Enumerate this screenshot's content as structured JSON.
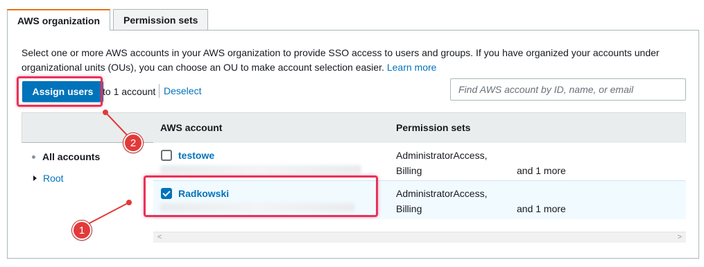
{
  "tabs": [
    {
      "label": "AWS organization",
      "active": true
    },
    {
      "label": "Permission sets",
      "active": false
    }
  ],
  "description": {
    "text": "Select one or more AWS accounts in your AWS organization to provide SSO access to users and groups. If you have organized your accounts under organizational units (OUs), you can choose an OU to make account selection easier. ",
    "learn_more": "Learn more"
  },
  "toolbar": {
    "assign_label": "Assign users",
    "assign_suffix": "to 1 account",
    "deselect_label": "Deselect",
    "search_placeholder": "Find AWS account by ID, name, or email"
  },
  "tree": {
    "all_accounts": "All accounts",
    "root": "Root"
  },
  "table": {
    "headers": [
      "AWS account",
      "Permission sets"
    ],
    "rows": [
      {
        "name": "testowe",
        "checked": false,
        "perm_line1": "AdministratorAccess,",
        "perm_line2": "Billing",
        "more": "and 1 more"
      },
      {
        "name": "Radkowski",
        "checked": true,
        "perm_line1": "AdministratorAccess,",
        "perm_line2": "Billing",
        "more": "and 1 more"
      }
    ]
  },
  "scrollbar": {
    "left_arrow": "<",
    "right_arrow": ">"
  },
  "annotations": {
    "marker_1": "1",
    "marker_2": "2",
    "highlight_color": "#e8325a"
  },
  "colors": {
    "accent": "#0073bb",
    "tab_active_border": "#ec7211"
  }
}
